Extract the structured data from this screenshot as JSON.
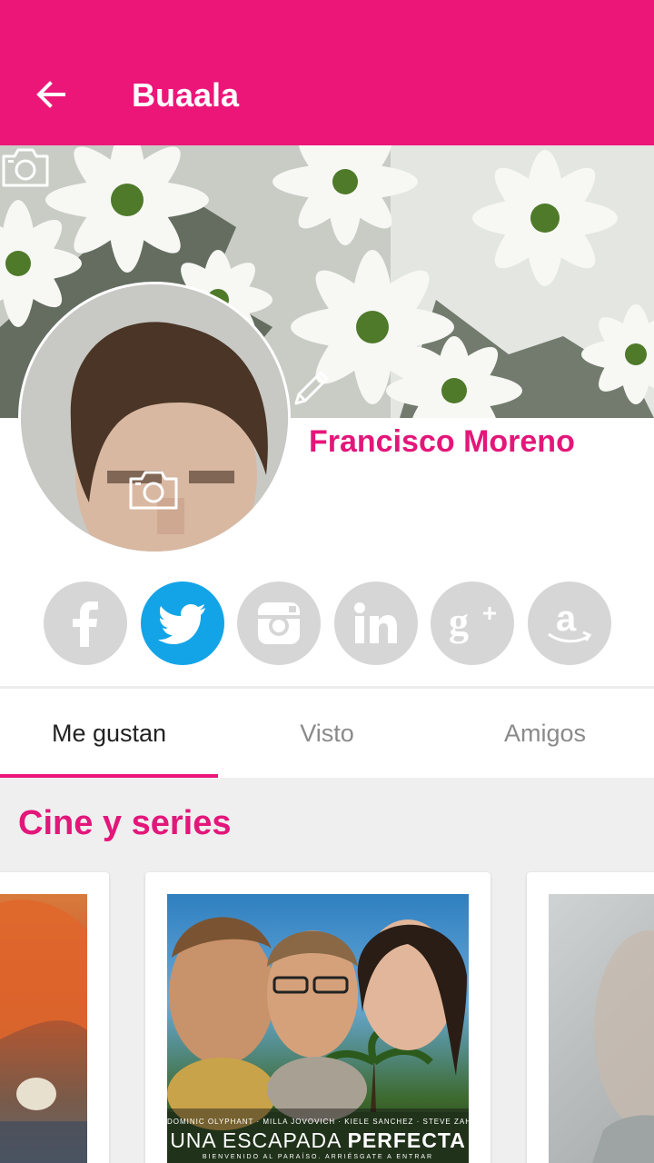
{
  "app_bar": {
    "title": "Buaala",
    "back_icon": "arrow-left-icon",
    "color": "#ec1679"
  },
  "profile": {
    "name": "Francisco Moreno",
    "name_color": "#e3177a",
    "cover_camera_icon": "camera-icon",
    "photo_camera_icon": "camera-icon",
    "edit_icon": "pencil-icon"
  },
  "social": [
    {
      "name": "facebook",
      "icon": "facebook-icon",
      "active": false
    },
    {
      "name": "twitter",
      "icon": "twitter-icon",
      "active": true
    },
    {
      "name": "instagram",
      "icon": "instagram-icon",
      "active": false
    },
    {
      "name": "linkedin",
      "icon": "linkedin-icon",
      "active": false
    },
    {
      "name": "google-plus",
      "icon": "google-plus-icon",
      "active": false
    },
    {
      "name": "amazon",
      "icon": "amazon-icon",
      "active": false
    }
  ],
  "tabs": [
    {
      "label": "Me gustan",
      "active": true
    },
    {
      "label": "Visto",
      "active": false
    },
    {
      "label": "Amigos",
      "active": false
    }
  ],
  "section": {
    "title": "Cine y series"
  },
  "poster": {
    "credits": "DOMINIC OLYPHANT · MILLA JOVOVICH · KIELE SANCHEZ · STEVE ZAHN",
    "title_prefix": "UNA ESCAPADA",
    "title_emphasis": "PERFECTA",
    "tagline": "BIENVENIDO AL PARAÍSO. ARRIÉSGATE A ENTRAR"
  },
  "colors": {
    "accent": "#ec1679",
    "twitter": "#13a4e8",
    "inactive_social": "#d6d6d6"
  }
}
